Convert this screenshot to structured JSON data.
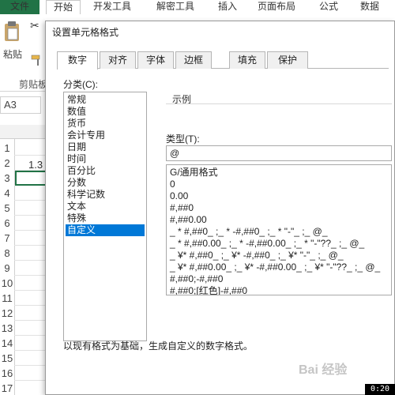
{
  "ribbon": {
    "tabs": [
      "文件",
      "开始",
      "开发工具",
      "解密工具",
      "插入",
      "页面布局",
      "公式",
      "数据"
    ],
    "paste_label": "粘贴",
    "clipboard_label": "剪贴板"
  },
  "sheet": {
    "name_box": "A3",
    "rows": [
      "1",
      "2",
      "3",
      "4",
      "5",
      "6",
      "7",
      "8",
      "9",
      "10",
      "11",
      "12",
      "13",
      "14",
      "15",
      "16",
      "17"
    ],
    "cell_b2": "1.3"
  },
  "dialog": {
    "title": "设置单元格格式",
    "tabs": [
      "数字",
      "对齐",
      "字体",
      "边框",
      "填充",
      "保护"
    ],
    "category_label": "分类(C):",
    "categories": [
      "常规",
      "数值",
      "货币",
      "会计专用",
      "日期",
      "时间",
      "百分比",
      "分数",
      "科学记数",
      "文本",
      "特殊",
      "自定义"
    ],
    "selected_category": "自定义",
    "sample_label": "示例",
    "type_label": "类型(T):",
    "type_value": "@",
    "formats": [
      "G/通用格式",
      "0",
      "0.00",
      "#,##0",
      "#,##0.00",
      "_ * #,##0_ ;_ * -#,##0_ ;_ * \"-\"_ ;_ @_",
      "_ * #,##0.00_ ;_ * -#,##0.00_ ;_ * \"-\"??_ ;_ @_",
      "_ ¥* #,##0_ ;_ ¥* -#,##0_ ;_ ¥* \"-\"_ ;_ @_",
      "_ ¥* #,##0.00_ ;_ ¥* -#,##0.00_ ;_ ¥* \"-\"??_ ;_ @_",
      "#,##0;-#,##0",
      "#,##0;[红色]-#,##0"
    ],
    "description": "以现有格式为基础，生成自定义的数字格式。"
  },
  "watermark": "Bai 经验",
  "timer": "0:20",
  "colors": {
    "excel_green": "#217346",
    "selection_blue": "#0078d7"
  }
}
